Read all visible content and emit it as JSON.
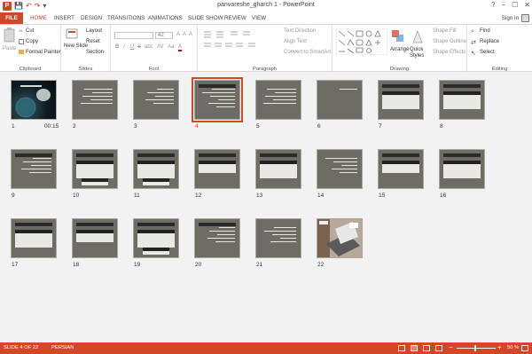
{
  "window": {
    "title": "panvareshe_gharch 1 - PowerPoint",
    "minimize": "−",
    "maximize": "☐",
    "close": "✕",
    "restore_help": "?"
  },
  "qat": {
    "logo": "P",
    "save": "💾",
    "undo": "↶",
    "redo": "↷",
    "customize": "▾"
  },
  "tabs": [
    "FILE",
    "HOME",
    "INSERT",
    "DESIGN",
    "TRANSITIONS",
    "ANIMATIONS",
    "SLIDE SHOW",
    "REVIEW",
    "VIEW"
  ],
  "active_tab": "HOME",
  "signin": "Sign in",
  "ribbon": {
    "clipboard": {
      "label": "Clipboard",
      "paste": "Paste",
      "cut": "Cut",
      "copy": "Copy",
      "format_painter": "Format Painter"
    },
    "slides": {
      "label": "Slides",
      "new_slide": "New Slide",
      "layout": "Layout",
      "reset": "Reset",
      "section": "Section"
    },
    "font": {
      "label": "Font",
      "font_size": "42",
      "bold": "B",
      "italic": "I",
      "underline": "U",
      "strike": "S",
      "shadow": "abc",
      "spacing": "AV",
      "case": "Aa",
      "color": "A",
      "grow": "A",
      "shrink": "A",
      "clear": "A"
    },
    "paragraph": {
      "label": "Paragraph",
      "text_direction": "Text Direction",
      "align_text": "Align Text",
      "convert_smartart": "Convert to SmartArt"
    },
    "drawing": {
      "label": "Drawing",
      "arrange": "Arrange",
      "quick_styles": "Quick Styles",
      "shape_fill": "Shape Fill",
      "shape_outline": "Shape Outline",
      "shape_effects": "Shape Effects"
    },
    "editing": {
      "label": "Editing",
      "find": "Find",
      "replace": "Replace",
      "select": "Select"
    }
  },
  "slides": [
    {
      "num": "1",
      "time": "00:15"
    },
    {
      "num": "2"
    },
    {
      "num": "3"
    },
    {
      "num": "4",
      "selected": true
    },
    {
      "num": "5"
    },
    {
      "num": "6"
    },
    {
      "num": "7"
    },
    {
      "num": "8"
    },
    {
      "num": "9"
    },
    {
      "num": "10"
    },
    {
      "num": "11"
    },
    {
      "num": "12"
    },
    {
      "num": "13"
    },
    {
      "num": "14"
    },
    {
      "num": "15"
    },
    {
      "num": "16"
    },
    {
      "num": "17"
    },
    {
      "num": "18"
    },
    {
      "num": "19"
    },
    {
      "num": "20"
    },
    {
      "num": "21"
    },
    {
      "num": "22"
    }
  ],
  "status": {
    "slide_info": "SLIDE 4 OF 22",
    "language": "PERSIAN",
    "zoom_minus": "−",
    "zoom_plus": "+",
    "zoom_value": "50 %"
  },
  "colors": {
    "accent": "#d24726",
    "slide_bg": "#6d6d66"
  }
}
